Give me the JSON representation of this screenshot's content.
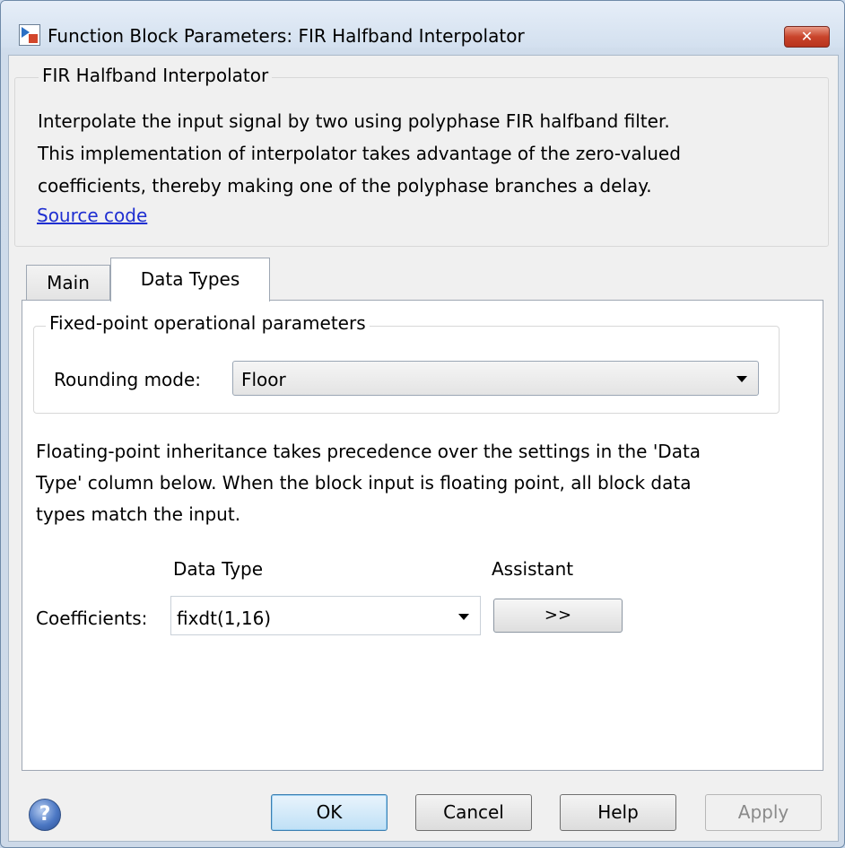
{
  "window": {
    "title": "Function Block Parameters: FIR Halfband Interpolator",
    "close_label": "✕"
  },
  "description": {
    "legend": "FIR Halfband Interpolator",
    "lines": [
      "Interpolate the input signal by two using polyphase FIR halfband filter.",
      "This implementation of interpolator takes advantage of the zero-valued",
      "coefficients, thereby making one of the polyphase branches a delay."
    ],
    "link": "Source code"
  },
  "tabs": [
    {
      "label": "Main",
      "active": false
    },
    {
      "label": "Data Types",
      "active": true
    }
  ],
  "fixed_point": {
    "legend": "Fixed-point operational parameters",
    "rounding_label": "Rounding mode:",
    "rounding_value": "Floor"
  },
  "floating_note": {
    "lines": [
      "Floating-point inheritance takes precedence over the settings in the 'Data",
      "Type' column below. When the block input is floating point, all block data",
      "types match the input."
    ]
  },
  "table": {
    "col_data_type": "Data Type",
    "col_assistant": "Assistant",
    "row_label": "Coefficients:",
    "row_value": "fixdt(1,16)",
    "assistant_button": ">>"
  },
  "buttons": {
    "help_icon": "?",
    "ok": "OK",
    "cancel": "Cancel",
    "help": "Help",
    "apply": "Apply"
  },
  "icons": {
    "window_icon": "simulink-block-icon",
    "help": "help-icon",
    "dropdown": "chevron-down-icon"
  },
  "colors": {
    "link": "#1f2fd1",
    "close_button": "#c9442b",
    "ok_button": "#bfe0f6"
  }
}
